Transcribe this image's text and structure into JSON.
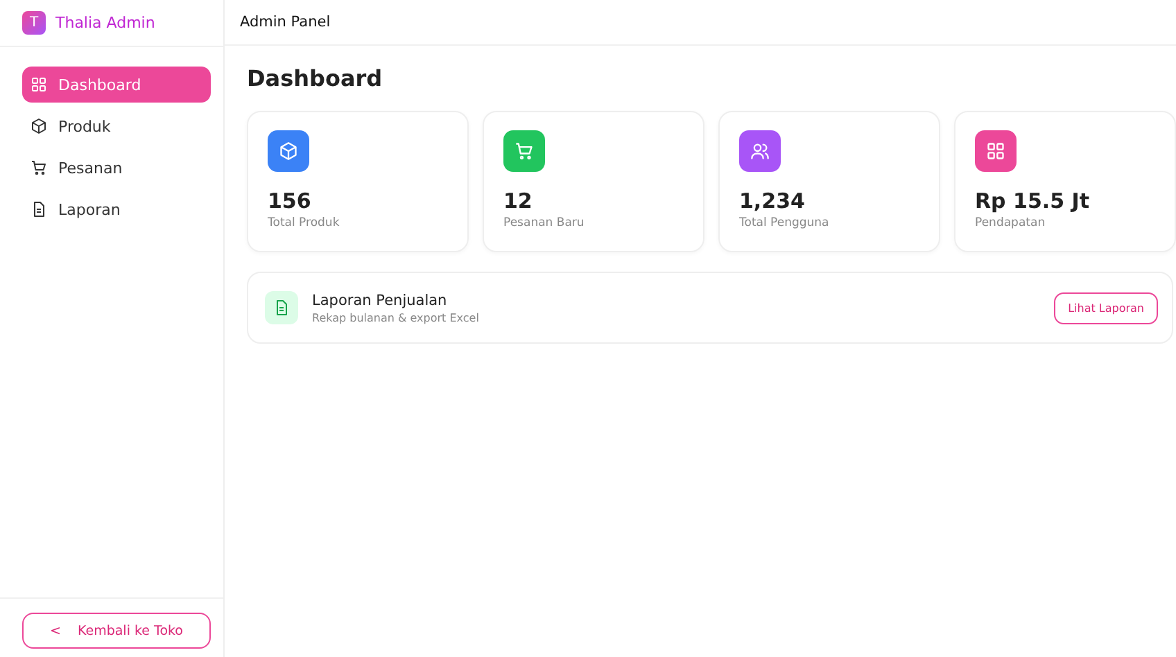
{
  "brand": {
    "initial": "T",
    "name": "Thalia Admin"
  },
  "header": {
    "title": "Admin Panel"
  },
  "nav": [
    {
      "label": "Dashboard",
      "kind": "grid",
      "selected": true
    },
    {
      "label": "Produk",
      "kind": "box",
      "selected": false
    },
    {
      "label": "Pesanan",
      "kind": "cart",
      "selected": false
    },
    {
      "label": "Laporan",
      "kind": "file",
      "selected": false
    }
  ],
  "back_button": {
    "icon": "<",
    "label": "Kembali ke Toko"
  },
  "page_title": "Dashboard",
  "stats": [
    {
      "value": "156",
      "label": "Total Produk",
      "kind": "box",
      "color": "#3b82f6"
    },
    {
      "value": "12",
      "label": "Pesanan Baru",
      "kind": "cart",
      "color": "#22c55e"
    },
    {
      "value": "1,234",
      "label": "Total Pengguna",
      "kind": "users",
      "color": "#a855f7"
    },
    {
      "value": "Rp 15.5 Jt",
      "label": "Pendapatan",
      "kind": "grid",
      "color": "#ec4899"
    }
  ],
  "report": {
    "title": "Laporan Penjualan",
    "subtitle": "Rekap bulanan & export Excel",
    "button": "Lihat Laporan"
  }
}
